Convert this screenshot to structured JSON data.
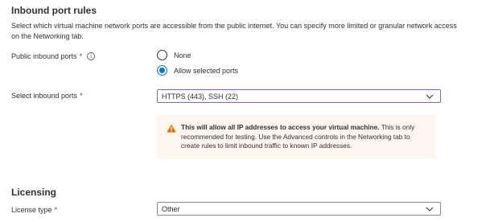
{
  "inbound": {
    "title": "Inbound port rules",
    "description": "Select which virtual machine network ports are accessible from the public internet. You can specify more limited or granular network access on the Networking tab.",
    "public_ports_label": "Public inbound ports",
    "required_mark": "*",
    "info_icon": "info-icon",
    "radio_options": [
      {
        "label": "None",
        "selected": false
      },
      {
        "label": "Allow selected ports",
        "selected": true
      }
    ],
    "select_ports_label": "Select inbound ports",
    "select_ports_value": "HTTPS (443), SSH (22)",
    "warning": {
      "icon": "warning-icon",
      "bold": "This will allow all IP addresses to access your virtual machine.",
      "text": " This is only recommended for testing.  Use the Advanced controls in the Networking tab to create rules to limit inbound traffic to known IP addresses."
    }
  },
  "licensing": {
    "title": "Licensing",
    "license_type_label": "License type",
    "required_mark": "*",
    "license_type_value": "Other"
  },
  "colors": {
    "accent": "#0078d4",
    "required": "#a4262c",
    "warning_bg": "#fdf6ee",
    "warning_icon": "#d47500",
    "focus_border": "#8661c5"
  }
}
